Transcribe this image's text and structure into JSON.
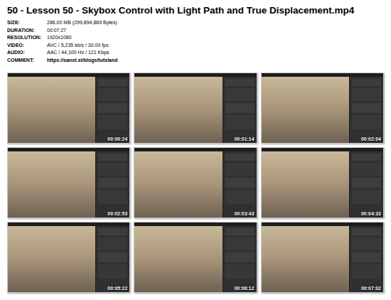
{
  "title": "50 - Lesson 50 - Skybox Control with Light Path and True Displacement.mp4",
  "info": [
    {
      "label": "SIZE:",
      "value": "286.00 MB (299,894,869 Bytes)"
    },
    {
      "label": "DURATION:",
      "value": "00:07:27"
    },
    {
      "label": "RESOLUTION:",
      "value": "1920x1080"
    },
    {
      "label": "VIDEO:",
      "value": "AVC / 5,235 kb/s / 30.00 fps"
    },
    {
      "label": "AUDIO:",
      "value": "AAC / 44,100 Hz / 121 Kbps"
    }
  ],
  "comment": {
    "label": "COMMENT:",
    "value": "https://sanet.st/blogs/tutsland"
  },
  "thumbnails": [
    {
      "time": "00:00:24"
    },
    {
      "time": "00:01:14"
    },
    {
      "time": "00:02:04"
    },
    {
      "time": "00:02:53"
    },
    {
      "time": "00:03:43"
    },
    {
      "time": "00:04:33"
    },
    {
      "time": "00:05:22"
    },
    {
      "time": "00:06:12"
    },
    {
      "time": "00:07:02"
    }
  ]
}
